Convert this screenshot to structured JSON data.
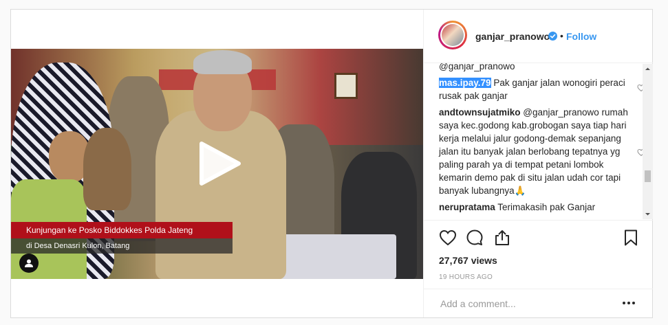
{
  "video": {
    "caption_line1": "Kunjungan ke Posko Biddokkes Polda Jateng",
    "caption_line2": "di Desa Denasri Kulon, Batang"
  },
  "header": {
    "username": "ganjar_pranowo",
    "separator": "•",
    "follow_label": "Follow"
  },
  "comments": {
    "partial_mention": "@ganjar_pranowo",
    "items": [
      {
        "user": "mas.ipay.79",
        "text": "Pak ganjar jalan wonogiri peraci rusak pak ganjar"
      },
      {
        "user": "andtownsujatmiko",
        "text": "@ganjar_pranowo rumah saya kec.godong kab.grobogan saya tiap hari kerja melalui jalur godong-demak sepanjang jalan itu banyak jalan berlobang tepatnya yg paling parah ya di tempat petani lombok kemarin demo pak di situ jalan udah cor tapi banyak lubangnya🙏"
      },
      {
        "user": "nerupratama",
        "text": "Terimakasih pak Ganjar"
      }
    ]
  },
  "stats": {
    "views": "27,767 views",
    "time_ago": "19 HOURS AGO"
  },
  "add_comment": {
    "placeholder": "Add a comment..."
  },
  "colors": {
    "link": "#3897f0",
    "selection": "#3390ff",
    "caption_red": "#b0101a"
  },
  "icons": [
    "play-icon",
    "user-tag-icon",
    "verified-badge-icon",
    "heart-icon",
    "comment-icon",
    "share-icon",
    "bookmark-icon",
    "more-options-icon"
  ]
}
